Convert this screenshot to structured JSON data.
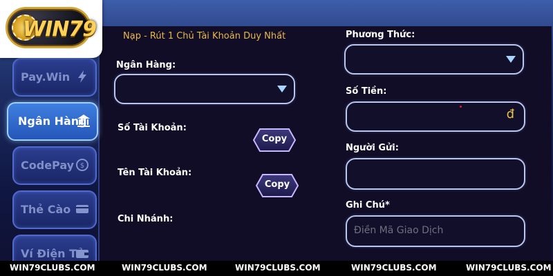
{
  "logo": {
    "text": "WIN79"
  },
  "sidebar": {
    "items": [
      {
        "label": "Pay.Win",
        "icon": "lightning-icon",
        "active": false
      },
      {
        "label": "Ngân Hàng",
        "icon": "bank-icon",
        "active": true
      },
      {
        "label": "CodePay",
        "icon": "coin-icon",
        "active": false
      },
      {
        "label": "Thẻ Cào",
        "icon": "card-icon",
        "active": false
      },
      {
        "label": "Ví Điện Tử",
        "icon": "wallet-icon",
        "active": false
      }
    ]
  },
  "form": {
    "notice": "Nạp - Rút 1 Chủ Tài Khoản Duy Nhất",
    "bank_label": "Ngân Hàng:",
    "bank_value": "",
    "account_number_label": "Số Tài Khoản:",
    "account_name_label": "Tên Tài Khoản:",
    "branch_label": "Chi Nhánh:",
    "copy_label": "Copy",
    "method_label": "Phương Thức:",
    "method_value": "",
    "amount_label": "Số Tiền:",
    "amount_currency": "đ",
    "sender_label": "Người Gửi:",
    "sender_value": "",
    "note_label": "Ghi Chú*",
    "note_placeholder": "Điền Mã Giao Dịch"
  },
  "footer": {
    "items": [
      "WIN79CLUBS.COM",
      "WIN79CLUBS.COM",
      "WIN79CLUBS.COM",
      "WIN79CLUBS.COM",
      "WIN79CLUBS.COM"
    ]
  },
  "colors": {
    "accent": "#e8b84a",
    "panel": "#110d26",
    "active_tab": "#3f80e0",
    "input_border": "#b9c6f0"
  }
}
